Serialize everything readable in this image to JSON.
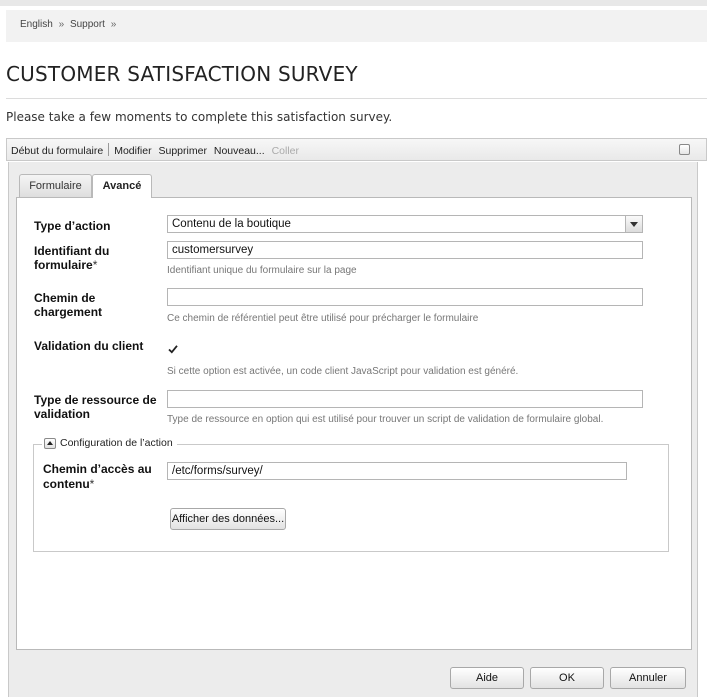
{
  "breadcrumb": {
    "items": [
      "English",
      "Support"
    ],
    "separator": "»"
  },
  "page": {
    "title": "CUSTOMER SATISFACTION SURVEY",
    "intro": "Please take a few moments to complete this satisfaction survey."
  },
  "toolbar": {
    "start_label": "Début du formulaire",
    "edit_label": "Modifier",
    "delete_label": "Supprimer",
    "new_label": "Nouveau...",
    "paste_label": "Coller"
  },
  "dialog": {
    "tabs": [
      {
        "label": "Formulaire",
        "active": false
      },
      {
        "label": "Avancé",
        "active": true
      }
    ],
    "fields": {
      "action_type": {
        "label": "Type d’action",
        "value": "Contenu de la boutique"
      },
      "form_id": {
        "label": "Identifiant du formulaire",
        "required_mark": "*",
        "value": "customersurvey",
        "hint": "Identifiant unique du formulaire sur la page"
      },
      "load_path": {
        "label": "Chemin de chargement",
        "value": "",
        "hint": "Ce chemin de référentiel peut être utilisé pour précharger le formulaire"
      },
      "client_validation": {
        "label": "Validation du client",
        "checked": true,
        "hint": "Si cette option est activée, un code client JavaScript pour validation est généré."
      },
      "validation_resource": {
        "label": "Type de ressource de validation",
        "value": "",
        "hint": "Type de ressource en option qui est utilisé pour trouver un script de validation de formulaire global."
      }
    },
    "action_config": {
      "legend": "Configuration de l’action",
      "content_path": {
        "label": "Chemin d’accès au contenu",
        "required_mark": "*",
        "value": "/etc/forms/survey/"
      },
      "view_data_button": "Afficher des données..."
    },
    "buttons": {
      "help": "Aide",
      "ok": "OK",
      "cancel": "Annuler"
    }
  },
  "colors": {
    "panel_bg": "#ffffff",
    "dialog_bg": "#ececec",
    "border": "#b9b9b9"
  }
}
